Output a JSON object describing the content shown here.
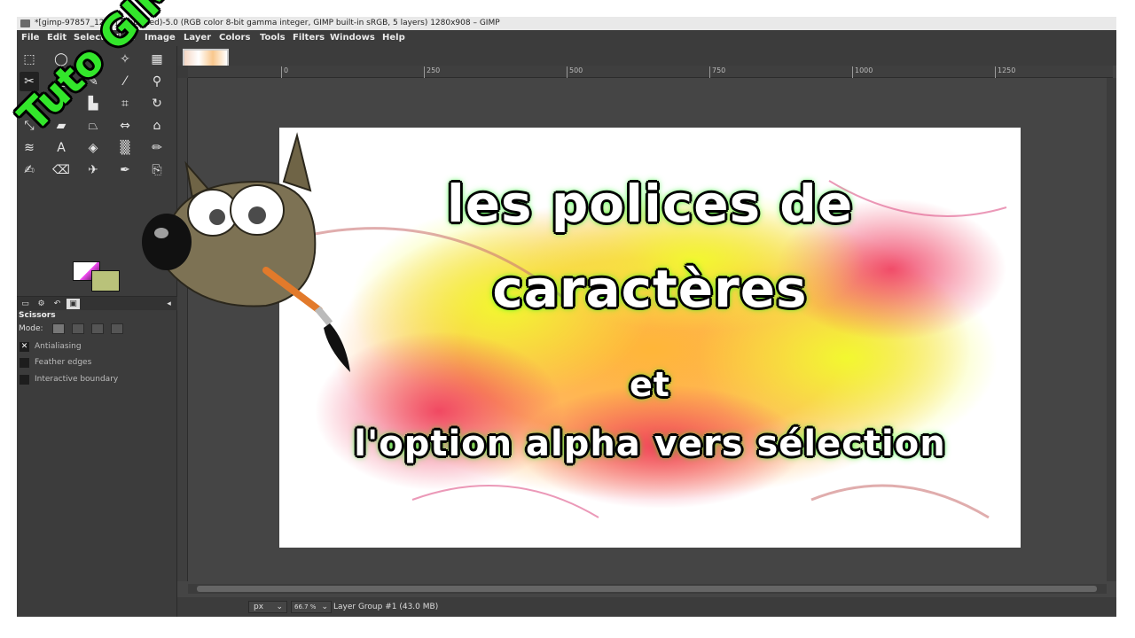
{
  "window": {
    "title": "*[gimp-97857_1280] (imported)-5.0 (RGB color 8-bit gamma integer, GIMP built-in sRGB, 5 layers) 1280x908 – GIMP"
  },
  "menu": [
    "File",
    "Edit",
    "Select",
    "View",
    "Image",
    "Layer",
    "Colors",
    "Tools",
    "Filters",
    "Windows",
    "Help"
  ],
  "toolbox": {
    "tools": [
      {
        "icon": "rect-select-icon",
        "glyph": "⬚"
      },
      {
        "icon": "ellipse-select-icon",
        "glyph": "◯"
      },
      {
        "icon": "free-select-icon",
        "glyph": "ϕ"
      },
      {
        "icon": "fuzzy-select-icon",
        "glyph": "✧"
      },
      {
        "icon": "by-color-select-icon",
        "glyph": "▦"
      },
      {
        "icon": "scissors-select-icon",
        "glyph": "✂"
      },
      {
        "icon": "foreground-select-icon",
        "glyph": "▣"
      },
      {
        "icon": "paths-icon",
        "glyph": "✎"
      },
      {
        "icon": "color-picker-icon",
        "glyph": "⁄"
      },
      {
        "icon": "zoom-icon",
        "glyph": "⚲"
      },
      {
        "icon": "measure-icon",
        "glyph": "⧍"
      },
      {
        "icon": "move-icon",
        "glyph": "✥"
      },
      {
        "icon": "align-icon",
        "glyph": "▙"
      },
      {
        "icon": "crop-icon",
        "glyph": "⌗"
      },
      {
        "icon": "rotate-icon",
        "glyph": "↻"
      },
      {
        "icon": "scale-icon",
        "glyph": "⤡"
      },
      {
        "icon": "shear-icon",
        "glyph": "▰"
      },
      {
        "icon": "perspective-icon",
        "glyph": "⏢"
      },
      {
        "icon": "flip-icon",
        "glyph": "⇔"
      },
      {
        "icon": "cage-icon",
        "glyph": "⌂"
      },
      {
        "icon": "warp-icon",
        "glyph": "≋"
      },
      {
        "icon": "text-icon",
        "glyph": "A"
      },
      {
        "icon": "bucket-fill-icon",
        "glyph": "◈"
      },
      {
        "icon": "blend-icon",
        "glyph": "▒"
      },
      {
        "icon": "pencil-icon",
        "glyph": "✏"
      },
      {
        "icon": "paintbrush-icon",
        "glyph": "✍"
      },
      {
        "icon": "eraser-icon",
        "glyph": "⌫"
      },
      {
        "icon": "airbrush-icon",
        "glyph": "✈"
      },
      {
        "icon": "ink-icon",
        "glyph": "✒"
      },
      {
        "icon": "clone-icon",
        "glyph": "⎘"
      }
    ],
    "dock_tabs": [
      "tool-options-tab-icon",
      "device-status-tab-icon",
      "undo-history-tab-icon",
      "images-tab-icon"
    ],
    "options_title": "Scissors",
    "mode_label": "Mode:",
    "options": [
      {
        "label": "Antialiasing",
        "checked": true
      },
      {
        "label": "Feather edges",
        "checked": false
      },
      {
        "label": "Interactive boundary",
        "checked": false
      }
    ]
  },
  "ruler": {
    "marks": [
      "0",
      "250",
      "500",
      "750",
      "1000",
      "1250"
    ]
  },
  "canvas": {
    "text_line1": "les polices de",
    "text_line2": "caractères",
    "text_line3": "et",
    "text_line4": "l'option alpha vers sélection"
  },
  "overlay": {
    "tuto": "Tuto GIMP"
  },
  "status": {
    "unit": "px",
    "zoom": "66.7 %",
    "text": "Layer Group #1 (43.0 MB)"
  },
  "colors": {
    "accent_green": "#33e62b",
    "ui_dark": "#3c3c3c",
    "canvas_bg": "#454545"
  }
}
